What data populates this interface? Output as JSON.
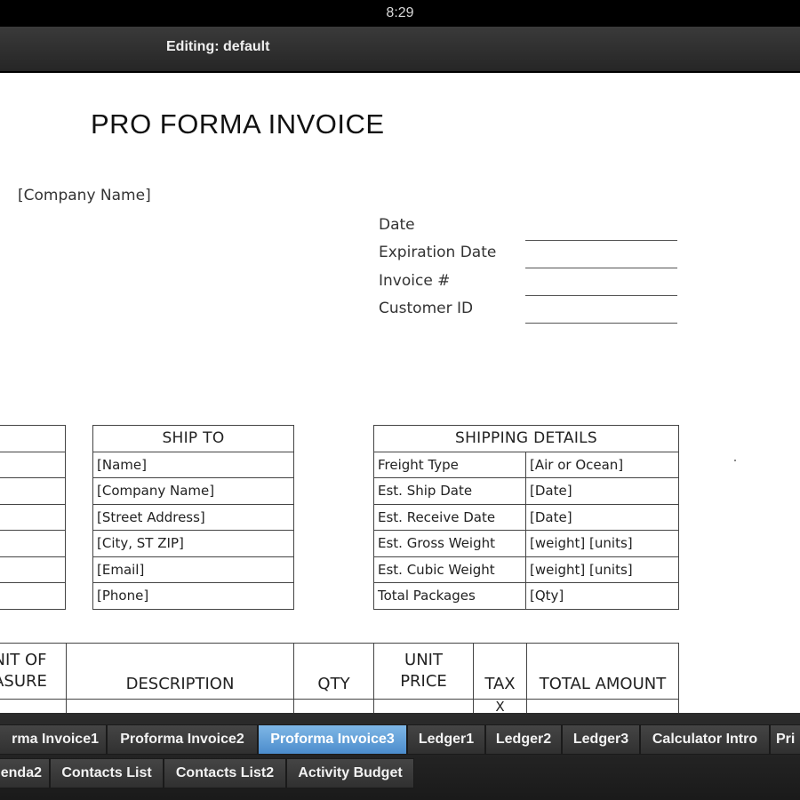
{
  "status_bar": {
    "time": "8:29"
  },
  "title_bar": {
    "title": "Editing: default"
  },
  "document": {
    "title": "PRO FORMA INVOICE",
    "company_name": "[Company Name]",
    "meta_fields": [
      "Date",
      "Expiration Date",
      "Invoice #",
      "Customer ID"
    ],
    "ship_to": {
      "header": "SHIP TO",
      "rows": [
        "[Name]",
        "[Company Name]",
        "[Street Address]",
        "[City, ST  ZIP]",
        "[Email]",
        "[Phone]"
      ]
    },
    "shipping_details": {
      "header": "SHIPPING DETAILS",
      "rows": [
        [
          "Freight Type",
          "[Air or Ocean]"
        ],
        [
          "Est. Ship Date",
          "[Date]"
        ],
        [
          "Est. Receive Date",
          "[Date]"
        ],
        [
          "Est. Gross Weight",
          "[weight] [units]"
        ],
        [
          "Est. Cubic Weight",
          "[weight] [units]"
        ],
        [
          "Total Packages",
          "[Qty]"
        ]
      ]
    },
    "items_table": {
      "headers": {
        "unit_of_measure_line1": "NIT OF",
        "unit_of_measure_line2": "ASURE",
        "description": "DESCRIPTION",
        "qty": "QTY",
        "unit_price_line1": "UNIT",
        "unit_price_line2": "PRICE",
        "tax": "TAX",
        "total_amount": "TOTAL AMOUNT"
      },
      "first_row_tax": "X"
    }
  },
  "sheet_tabs": {
    "row1": [
      "rma Invoice1",
      "Proforma Invoice2",
      "Proforma Invoice3",
      "Ledger1",
      "Ledger2",
      "Ledger3",
      "Calculator Intro",
      "Pri"
    ],
    "row2": [
      "enda2",
      "Contacts List",
      "Contacts List2",
      "Activity Budget"
    ],
    "active": "Proforma Invoice3"
  },
  "colors": {
    "active_tab": "#5a9ad6",
    "tab_bg": "#3a3a3a",
    "doc_bg": "#ffffff"
  }
}
